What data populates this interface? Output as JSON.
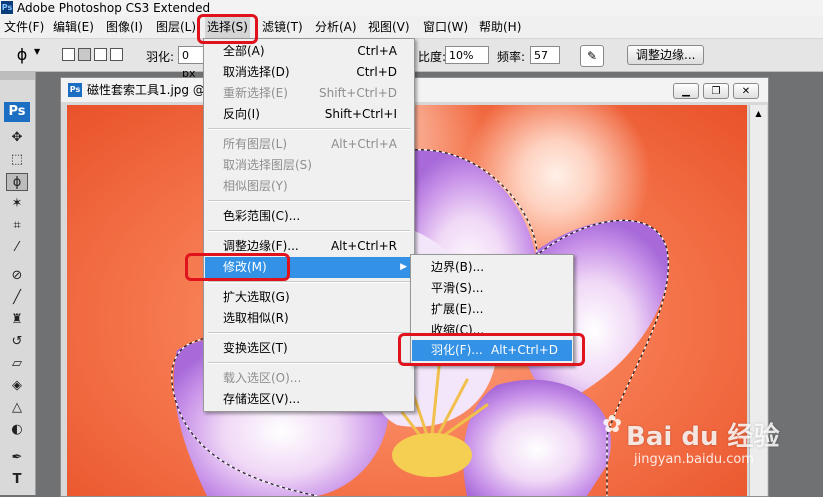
{
  "app": {
    "title": "Adobe Photoshop CS3 Extended",
    "logo": "Ps"
  },
  "menubar": [
    {
      "label": "文件(F)"
    },
    {
      "label": "编辑(E)"
    },
    {
      "label": "图像(I)"
    },
    {
      "label": "图层(L)"
    },
    {
      "label": "选择(S)"
    },
    {
      "label": "滤镜(T)"
    },
    {
      "label": "分析(A)"
    },
    {
      "label": "视图(V)"
    },
    {
      "label": "窗口(W)"
    },
    {
      "label": "帮助(H)"
    }
  ],
  "options": {
    "feather_label": "羽化:",
    "feather_value": "0 px",
    "contrast_label": "比度:",
    "contrast_value": "10%",
    "frequency_label": "频率:",
    "frequency_value": "57",
    "refine_edge": "调整边缘..."
  },
  "document": {
    "title": "磁性套索工具1.jpg @"
  },
  "select_menu": [
    {
      "label": "全部(A)",
      "shortcut": "Ctrl+A",
      "enabled": true
    },
    {
      "label": "取消选择(D)",
      "shortcut": "Ctrl+D",
      "enabled": true
    },
    {
      "label": "重新选择(E)",
      "shortcut": "Shift+Ctrl+D",
      "enabled": false
    },
    {
      "label": "反向(I)",
      "shortcut": "Shift+Ctrl+I",
      "enabled": true
    },
    {
      "label": "所有图层(L)",
      "shortcut": "Alt+Ctrl+A",
      "enabled": false
    },
    {
      "label": "取消选择图层(S)",
      "shortcut": "",
      "enabled": false
    },
    {
      "label": "相似图层(Y)",
      "shortcut": "",
      "enabled": false
    },
    {
      "label": "色彩范围(C)...",
      "shortcut": "",
      "enabled": true
    },
    {
      "label": "调整边缘(F)...",
      "shortcut": "Alt+Ctrl+R",
      "enabled": true
    },
    {
      "label": "修改(M)",
      "shortcut": "",
      "enabled": true
    },
    {
      "label": "扩大选取(G)",
      "shortcut": "",
      "enabled": true
    },
    {
      "label": "选取相似(R)",
      "shortcut": "",
      "enabled": true
    },
    {
      "label": "变换选区(T)",
      "shortcut": "",
      "enabled": true
    },
    {
      "label": "载入选区(O)...",
      "shortcut": "",
      "enabled": false
    },
    {
      "label": "存储选区(V)...",
      "shortcut": "",
      "enabled": true
    }
  ],
  "modify_menu": [
    {
      "label": "边界(B)...",
      "shortcut": ""
    },
    {
      "label": "平滑(S)...",
      "shortcut": ""
    },
    {
      "label": "扩展(E)...",
      "shortcut": ""
    },
    {
      "label": "收缩(C)...",
      "shortcut": ""
    },
    {
      "label": "羽化(F)...",
      "shortcut": "Alt+Ctrl+D"
    }
  ],
  "watermark": {
    "brand": "Bai du 经验",
    "url": "jingyan.baidu.com"
  },
  "colors": {
    "highlight": "#3392e5",
    "annotation": "#e0121c",
    "menu_bg": "#f0f0f0"
  },
  "icons": [
    "photoshop-icon",
    "lasso-tool-icon",
    "marquee-tool-icon",
    "move-tool-icon",
    "crop-tool-icon",
    "magic-wand-icon",
    "eyedropper-icon",
    "brush-icon",
    "stamp-icon",
    "eraser-icon",
    "paint-bucket-icon",
    "pen-icon",
    "text-icon",
    "submenu-arrow-icon"
  ]
}
